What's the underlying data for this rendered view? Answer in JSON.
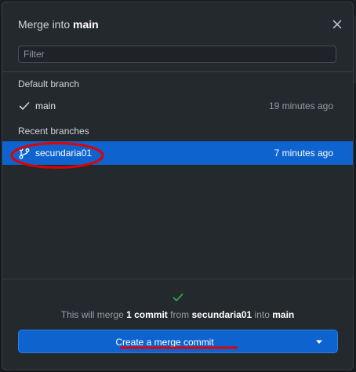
{
  "dialog": {
    "title_prefix": "Merge into ",
    "title_branch": "main",
    "close_icon": "close-icon"
  },
  "filter": {
    "placeholder": "Filter",
    "value": ""
  },
  "default_section": {
    "label": "Default branch",
    "branches": [
      {
        "name": "main",
        "time": "19 minutes ago",
        "icon": "check-icon"
      }
    ]
  },
  "recent_section": {
    "label": "Recent branches",
    "branches": [
      {
        "name": "secundaria01",
        "time": "7 minutes ago",
        "icon": "git-branch-icon",
        "selected": true
      }
    ]
  },
  "footer": {
    "status_icon": "check-icon",
    "summary_pre": "This will merge ",
    "summary_count": "1 commit",
    "summary_mid": " from ",
    "summary_source": "secundaria01",
    "summary_mid2": " into ",
    "summary_target": "main",
    "button_label": "Create a merge commit",
    "button_dropdown_icon": "caret-down-icon"
  },
  "colors": {
    "accent": "#0e63cf",
    "annotation": "#e00000",
    "success": "#28a745",
    "background": "#24292e"
  }
}
